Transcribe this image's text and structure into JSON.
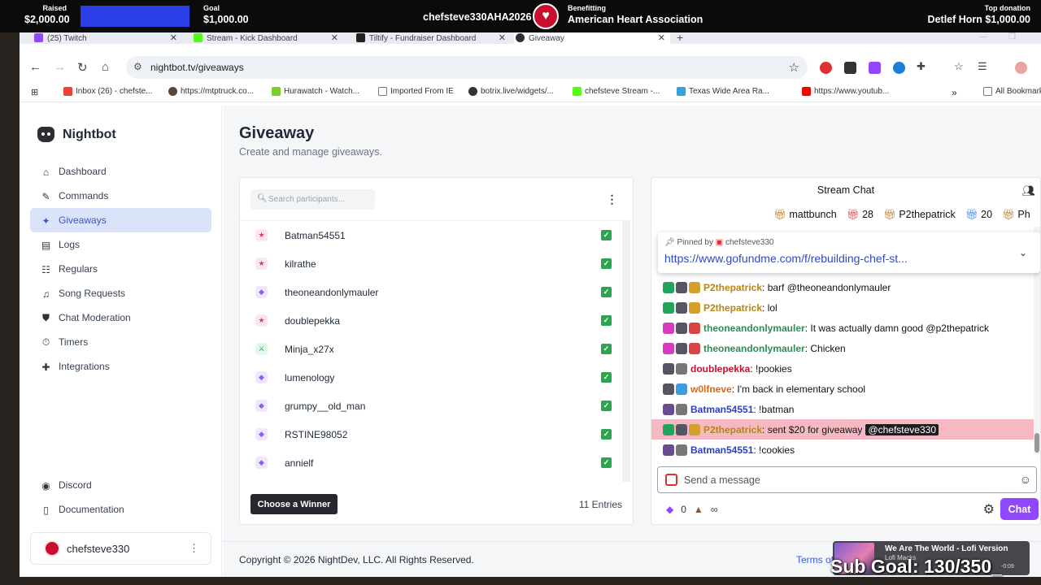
{
  "overlay": {
    "raised_label": "Raised",
    "raised_value": "$2,000.00",
    "progress_fraction": 1.0,
    "goal_label": "Goal",
    "goal_value": "$1,000.00",
    "event_name": "chefsteve330AHA2026",
    "benefitting_label": "Benefitting",
    "benefitting_value": "American Heart Association",
    "top_donation_label": "Top donation",
    "top_donation_value": "Detlef Horn $1,000.00"
  },
  "browser": {
    "tabs": [
      {
        "label": "(25) Twitch",
        "color": "#9146ff"
      },
      {
        "label": "Stream - Kick Dashboard",
        "color": "#53fc18"
      },
      {
        "label": "Tiltify - Fundraiser Dashboard",
        "color": "#222222"
      },
      {
        "label": "Giveaway",
        "color": "#2d2d33"
      }
    ],
    "url": "nightbot.tv/giveaways",
    "bookmarks": [
      {
        "label": "Inbox (26) - chefste...",
        "color": "#ea4335"
      },
      {
        "label": "https://mtptruck.co...",
        "color": "#5a4636"
      },
      {
        "label": "Hurawatch - Watch...",
        "color": "#7ccf2a"
      },
      {
        "label": "Imported From IE",
        "color": "#777777"
      },
      {
        "label": "botrix.live/widgets/...",
        "color": "#333333"
      },
      {
        "label": "chefsteve Stream -...",
        "color": "#53fc18"
      },
      {
        "label": "Texas Wide Area Ra...",
        "color": "#3aa0d8"
      },
      {
        "label": "https://www.youtub...",
        "color": "#ff0000"
      },
      {
        "label": "All Bookmarks",
        "color": "#777777"
      }
    ]
  },
  "sidebar": {
    "brand": "Nightbot",
    "items": [
      {
        "label": "Dashboard",
        "icon": "home-icon",
        "glyph": "⌂"
      },
      {
        "label": "Commands",
        "icon": "wand-icon",
        "glyph": "✎"
      },
      {
        "label": "Giveaways",
        "icon": "party-icon",
        "glyph": "✦"
      },
      {
        "label": "Logs",
        "icon": "logs-icon",
        "glyph": "▤"
      },
      {
        "label": "Regulars",
        "icon": "regulars-icon",
        "glyph": "☷"
      },
      {
        "label": "Song Requests",
        "icon": "headphones-icon",
        "glyph": "♫"
      },
      {
        "label": "Chat Moderation",
        "icon": "shield-icon",
        "glyph": "⛊"
      },
      {
        "label": "Timers",
        "icon": "timer-icon",
        "glyph": "⏱"
      },
      {
        "label": "Integrations",
        "icon": "puzzle-icon",
        "glyph": "✚"
      }
    ],
    "bottom": [
      {
        "label": "Discord",
        "icon": "discord-icon",
        "glyph": "◉"
      },
      {
        "label": "Documentation",
        "icon": "book-icon",
        "glyph": "▯"
      }
    ],
    "user": "chefsteve330"
  },
  "page": {
    "title": "Giveaway",
    "subtitle": "Create and manage giveaways."
  },
  "participants": {
    "search_placeholder": "Search participants...",
    "list": [
      {
        "name": "Batman54551",
        "role": "star"
      },
      {
        "name": "kilrathe",
        "role": "star"
      },
      {
        "name": "theoneandonlymauler",
        "role": "gem"
      },
      {
        "name": "doublepekka",
        "role": "star"
      },
      {
        "name": "Minja_x27x",
        "role": "sword"
      },
      {
        "name": "lumenology",
        "role": "gem"
      },
      {
        "name": "grumpy__old_man",
        "role": "gem"
      },
      {
        "name": "RSTINE98052",
        "role": "gem"
      },
      {
        "name": "annielf",
        "role": "gem"
      }
    ],
    "choose_button": "Choose a Winner",
    "entries": "11 Entries"
  },
  "chat": {
    "title": "Stream Chat",
    "gifts": [
      {
        "text": "mattbunch",
        "type": "g"
      },
      {
        "text": "28",
        "type": "gr"
      },
      {
        "text": "P2thepatrick",
        "type": "n"
      },
      {
        "text": "20",
        "type": "gb"
      },
      {
        "text": "Ph",
        "type": "g"
      }
    ],
    "pinned_by": "Pinned by",
    "pinned_user": "chefsteve330",
    "pinned_link": "https://www.gofundme.com/f/rebuilding-chef-st...",
    "messages": [
      {
        "user": "P2thepatrick",
        "color": "#b8860b",
        "text": ": barf @theoneandonlymauler",
        "badges": [
          "#22a45d",
          "#555566",
          "#d4a02a"
        ]
      },
      {
        "user": "P2thepatrick",
        "color": "#b8860b",
        "text": ": lol",
        "badges": [
          "#22a45d",
          "#555566",
          "#d4a02a"
        ]
      },
      {
        "user": "theoneandonlymauler",
        "color": "#2e8b57",
        "text": ": It was actually damn good @p2thepatrick",
        "badges": [
          "#d63dbe",
          "#555566",
          "#d94444"
        ]
      },
      {
        "user": "theoneandonlymauler",
        "color": "#2e8b57",
        "text": ": Chicken",
        "badges": [
          "#d63dbe",
          "#555566",
          "#d94444"
        ]
      },
      {
        "user": "doublepekka",
        "color": "#c8102e",
        "text": ": !pookies",
        "badges": [
          "#555566",
          "#777777"
        ]
      },
      {
        "user": "w0lfneve",
        "color": "#d2691e",
        "text": ": I'm back in elementary school",
        "badges": [
          "#555566",
          "#3b9ce0"
        ]
      },
      {
        "user": "Batman54551",
        "color": "#2a3fc7",
        "text": ": !batman",
        "badges": [
          "#6a4c93",
          "#777777"
        ]
      },
      {
        "user": "P2thepatrick",
        "color": "#b8860b",
        "text": ": sent $20 for giveaway",
        "badges": [
          "#22a45d",
          "#555566",
          "#d4a02a"
        ],
        "mention": "@chefsteve330",
        "highlight": true
      },
      {
        "user": "Batman54551",
        "color": "#2a3fc7",
        "text": ": !cookies",
        "badges": [
          "#6a4c93",
          "#777777"
        ]
      }
    ],
    "input_placeholder": "Send a message",
    "points": "0",
    "infinity": "∞",
    "send_button": "Chat"
  },
  "footer": {
    "copyright": "Copyright © 2026 NightDev, LLC. All Rights Reserved.",
    "terms": "Terms of"
  },
  "music": {
    "title": "We Are The World - Lofi Version",
    "artist": "Lofi Macks",
    "time": "-0:09"
  },
  "subgoal": "Sub Goal: 130/350_"
}
